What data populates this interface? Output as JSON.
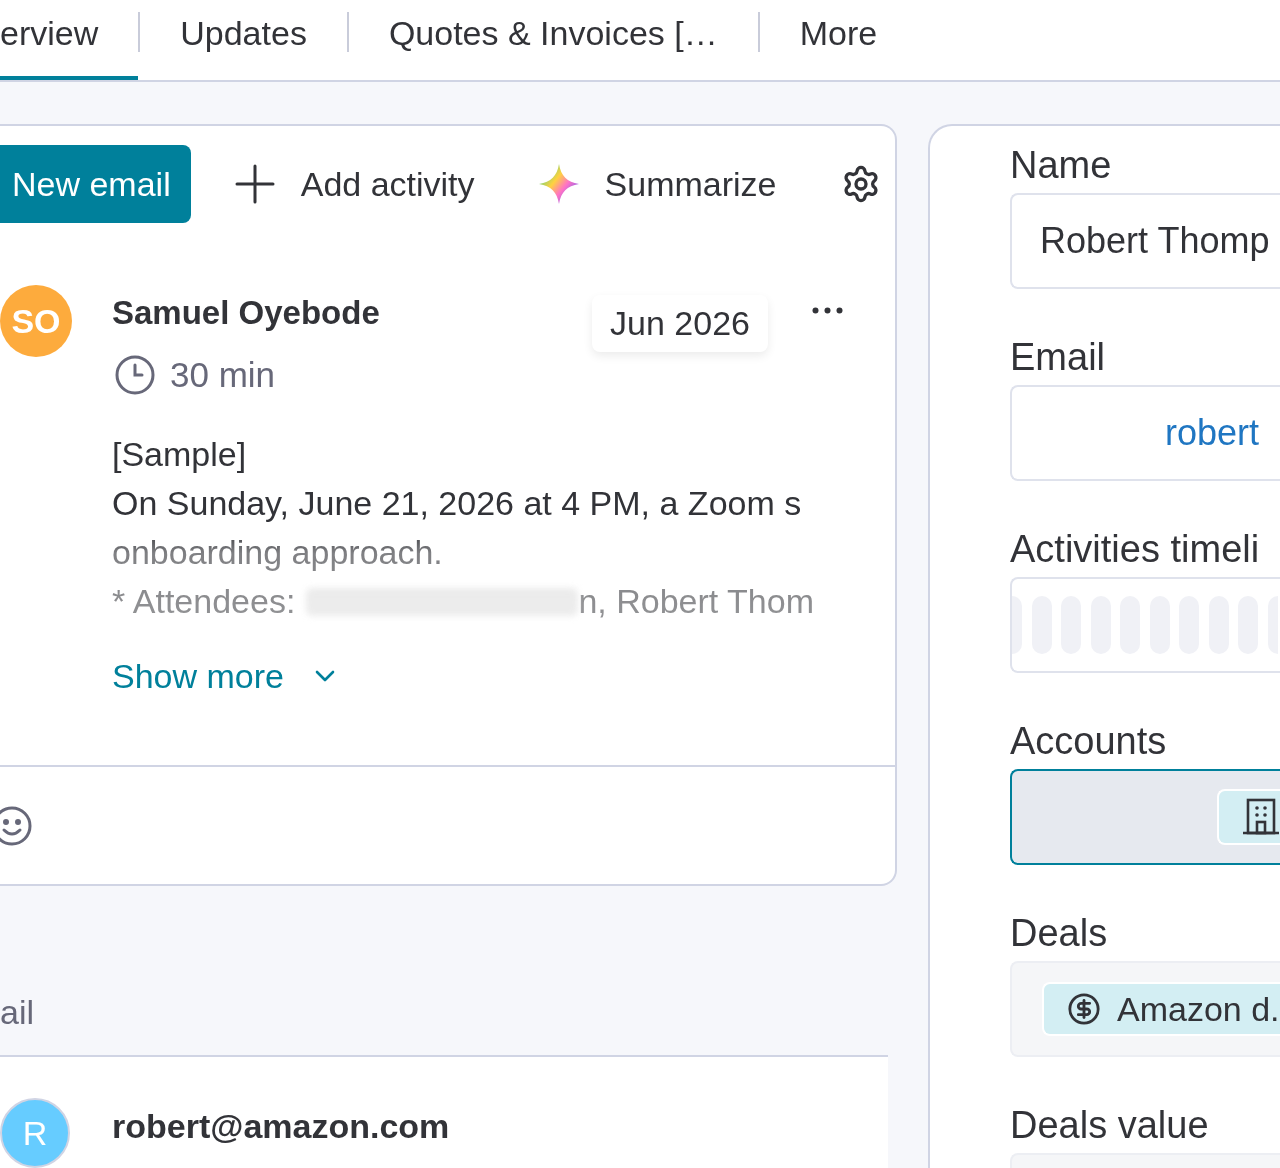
{
  "tabs": [
    {
      "label": "erview",
      "selected": true
    },
    {
      "label": "Updates",
      "selected": false
    },
    {
      "label": "Quotes & Invoices […",
      "selected": false
    },
    {
      "label": "More",
      "selected": false
    }
  ],
  "toolbar": {
    "primary_button": "New email",
    "actions": [
      {
        "kind": "add",
        "label": "Add activity"
      },
      {
        "kind": "ai",
        "label": "Summarize"
      }
    ]
  },
  "activity": {
    "initials": "SO",
    "author": "Samuel Oyebode",
    "date": "Jun 2026",
    "duration": "30 min",
    "body": [
      "[Sample]",
      "On Sunday, June 21, 2026 at 4 PM, a Zoom s",
      "onboarding approach."
    ],
    "attendees": {
      "label": "* Attendees:",
      "names": "n, Robert Thom"
    },
    "show_more": "Show more"
  },
  "email_section": {
    "title": "ail",
    "initial": "R",
    "address": "robert@amazon.com"
  },
  "fields": [
    {
      "label": "Name",
      "kind": "text",
      "value": "Robert Thomp",
      "focused": false
    },
    {
      "label": "Email",
      "kind": "email",
      "value": "robert",
      "focused": false
    },
    {
      "label": "Activities timeli",
      "kind": "timeline",
      "focused": false
    },
    {
      "label": "Accounts",
      "kind": "connect",
      "focused": true,
      "chips": [
        {
          "kind": "account"
        }
      ]
    },
    {
      "label": "Deals",
      "kind": "connect",
      "focused": false,
      "chips": [
        {
          "kind": "deal",
          "label": "Amazon d."
        }
      ]
    },
    {
      "label": "Deals value",
      "kind": "readonly",
      "focused": false
    }
  ]
}
